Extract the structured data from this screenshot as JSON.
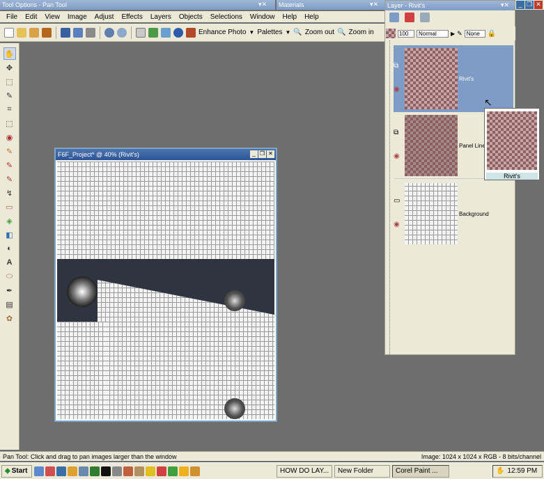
{
  "tool_options": {
    "title": "Tool Options - Pan Tool",
    "ctrl": "▾✕"
  },
  "materials": {
    "title": "Materials",
    "ctrl": "▾✕"
  },
  "layer_palette_title": "Layer - Rivit's",
  "layer_ctrl": "▾✕",
  "win_ctrl": {
    "min": "_",
    "max": "❐",
    "close": "✕"
  },
  "menu": [
    "File",
    "Edit",
    "View",
    "Image",
    "Adjust",
    "Effects",
    "Layers",
    "Objects",
    "Selections",
    "Window",
    "Help",
    "Help"
  ],
  "toolbar": {
    "enhance": "Enhance Photo",
    "palettes": "Palettes",
    "zoom_out": "Zoom out",
    "zoom_in": "Zoom in"
  },
  "layer_toolbar": {
    "opacity": "100",
    "blend": "Normal",
    "mask": "None"
  },
  "layers": [
    {
      "name": "Rivit's"
    },
    {
      "name": "Panel Lines"
    },
    {
      "name": "Background"
    }
  ],
  "drag_tooltip": "Rivit's",
  "doc": {
    "title": "F6F_Project* @ 40% (Rivit's)"
  },
  "status": {
    "left": "Pan Tool: Click and drag to pan images larger than the window",
    "right": "Image:  1024 x 1024 x RGB - 8 bits/channel"
  },
  "taskbar": {
    "start": "Start",
    "tasks": [
      "HOW DO LAY...",
      "New Folder",
      "Corel Paint ..."
    ],
    "time": "12:59 PM"
  },
  "colors": {
    "titlebar": "#7f9cc6",
    "panel": "#ece9d8",
    "workspace": "#6e6e6e",
    "selected_layer": "#7f9cc6"
  }
}
